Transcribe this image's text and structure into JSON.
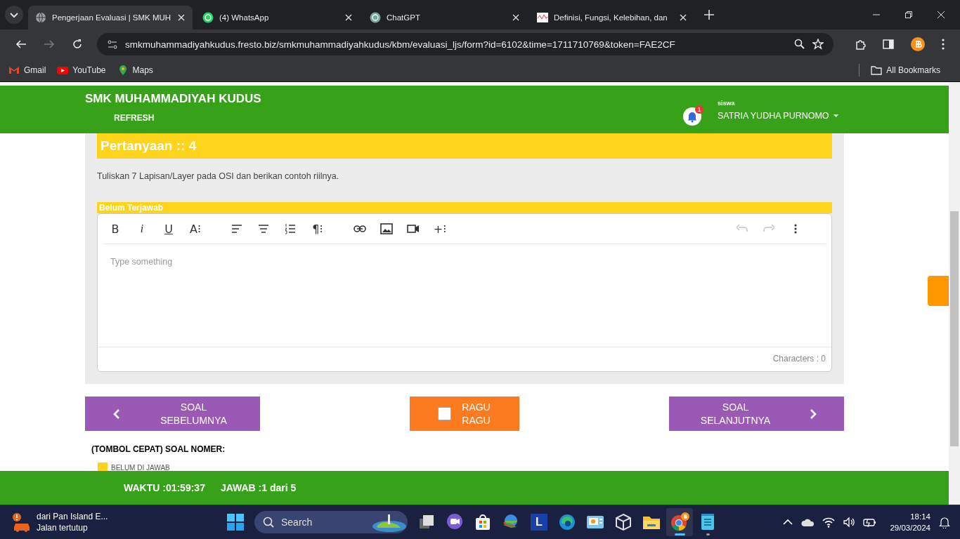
{
  "browser": {
    "tabs": [
      {
        "title": "Pengerjaan Evaluasi | SMK MUH",
        "selected": true
      },
      {
        "title": "(4) WhatsApp",
        "selected": false
      },
      {
        "title": "ChatGPT",
        "selected": false
      },
      {
        "title": "Definisi, Fungsi, Kelebihan, dan",
        "selected": false
      }
    ],
    "url": "smkmuhammadiyahkudus.fresto.biz/smkmuhammadiyahkudus/kbm/evaluasi_ljs/form?id=6102&time=1711710769&token=FAE2CF",
    "bookmarks": [
      {
        "label": "Gmail"
      },
      {
        "label": "YouTube"
      },
      {
        "label": "Maps"
      }
    ],
    "all_bookmarks": "All Bookmarks"
  },
  "header": {
    "school": "SMK MUHAMMADIYAH KUDUS",
    "refresh": "REFRESH",
    "notification_count": "1",
    "role": "siswa",
    "user": "SATRIA YUDHA PURNOMO"
  },
  "question": {
    "title": "Pertanyaan :: 4",
    "text": "Tuliskan 7 Lapisan/Layer pada OSI dan berikan contoh riilnya.",
    "status": "Belum Terjawab",
    "toolbar": [
      {
        "kind": "bold",
        "label": "B"
      },
      {
        "kind": "italic",
        "label": "i"
      },
      {
        "kind": "underline",
        "label": "U"
      },
      {
        "kind": "text",
        "label": "A⁝"
      },
      {
        "kind": "align-left"
      },
      {
        "kind": "align-center"
      },
      {
        "kind": "ordered-list"
      },
      {
        "kind": "text",
        "label": "¶⁝"
      },
      {
        "kind": "link"
      },
      {
        "kind": "image"
      },
      {
        "kind": "video"
      },
      {
        "kind": "text",
        "label": "+⁝"
      }
    ],
    "history": [
      {
        "kind": "undo",
        "disabled": true
      },
      {
        "kind": "redo",
        "disabled": true
      },
      {
        "kind": "more",
        "disabled": false
      }
    ],
    "placeholder": "Type something",
    "char_count": "Characters : 0"
  },
  "nav": {
    "prev": "SOAL SEBELUMNYA",
    "doubt": {
      "label": "RAGU RAGU",
      "checked": false
    },
    "next": "SOAL SELANJUTNYA"
  },
  "quick": {
    "title": "(TOMBOL CEPAT) SOAL NOMER:",
    "legend": [
      {
        "label": "BELUM DI JAWAB",
        "color": "#fdd31c"
      }
    ]
  },
  "footer": {
    "time": "WAKTU :01:59:37",
    "answered": "JAWAB :1 dari 5"
  },
  "taskbar": {
    "notice_title": "dari Pan Island E...",
    "notice_text": "Jalan tertutup",
    "search": "Search",
    "apps": [
      {
        "kind": "windows",
        "active": false,
        "running": false
      },
      {
        "kind": "taskview",
        "active": false,
        "running": false
      },
      {
        "kind": "meet",
        "active": false,
        "running": false
      },
      {
        "kind": "store",
        "active": false,
        "running": false
      },
      {
        "kind": "downloader",
        "active": false,
        "running": false
      },
      {
        "kind": "letter",
        "label": "L",
        "active": false,
        "running": false
      },
      {
        "kind": "edge",
        "active": false,
        "running": false
      },
      {
        "kind": "monitor",
        "active": false,
        "running": false
      },
      {
        "kind": "box",
        "active": false,
        "running": false
      },
      {
        "kind": "folder",
        "active": false,
        "running": false
      },
      {
        "kind": "chrome",
        "active": true,
        "running": true
      },
      {
        "kind": "notepad",
        "active": false,
        "running": true
      }
    ],
    "time": "18:14",
    "date": "29/03/2024"
  }
}
